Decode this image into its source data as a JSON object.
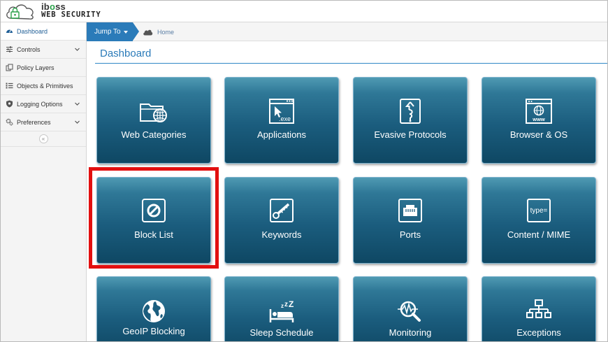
{
  "brand": {
    "name_a": "ib",
    "name_b": "o",
    "name_c": "ss",
    "subtitle": "WEB SECURITY",
    "accent_color": "#2aa24a"
  },
  "sidebar": {
    "items": [
      {
        "label": "Dashboard",
        "icon": "dashboard-gauge-icon",
        "active": true,
        "has_chevron": false
      },
      {
        "label": "Controls",
        "icon": "sliders-icon",
        "active": false,
        "has_chevron": true
      },
      {
        "label": "Policy Layers",
        "icon": "layers-icon",
        "active": false,
        "has_chevron": false
      },
      {
        "label": "Objects & Primitives",
        "icon": "list-icon",
        "active": false,
        "has_chevron": false
      },
      {
        "label": "Logging Options",
        "icon": "shield-icon",
        "active": false,
        "has_chevron": true
      },
      {
        "label": "Preferences",
        "icon": "gears-icon",
        "active": false,
        "has_chevron": true
      }
    ],
    "collapse_glyph": "«"
  },
  "toolbar": {
    "jump_label": "Jump To",
    "breadcrumb_home": "Home",
    "accent_color": "#2b7bb9"
  },
  "main": {
    "title": "Dashboard",
    "tiles": [
      {
        "label": "Web Categories",
        "icon": "folder-globe-icon"
      },
      {
        "label": "Applications",
        "icon": "exe-window-icon"
      },
      {
        "label": "Evasive Protocols",
        "icon": "evasive-protocol-icon"
      },
      {
        "label": "Browser & OS",
        "icon": "browser-www-icon"
      },
      {
        "label": "Block List",
        "icon": "block-icon"
      },
      {
        "label": "Keywords",
        "icon": "keyword-key-icon"
      },
      {
        "label": "Ports",
        "icon": "network-port-icon"
      },
      {
        "label": "Content / MIME",
        "icon": "type-mime-icon"
      },
      {
        "label": "GeoIP Blocking",
        "icon": "globe-icon"
      },
      {
        "label": "Sleep Schedule",
        "icon": "sleep-bed-icon"
      },
      {
        "label": "Monitoring",
        "icon": "monitoring-magnifier-icon"
      },
      {
        "label": "Exceptions",
        "icon": "hierarchy-icon"
      }
    ],
    "highlighted_tile": "Block List",
    "highlight_color": "#e20f0f"
  }
}
